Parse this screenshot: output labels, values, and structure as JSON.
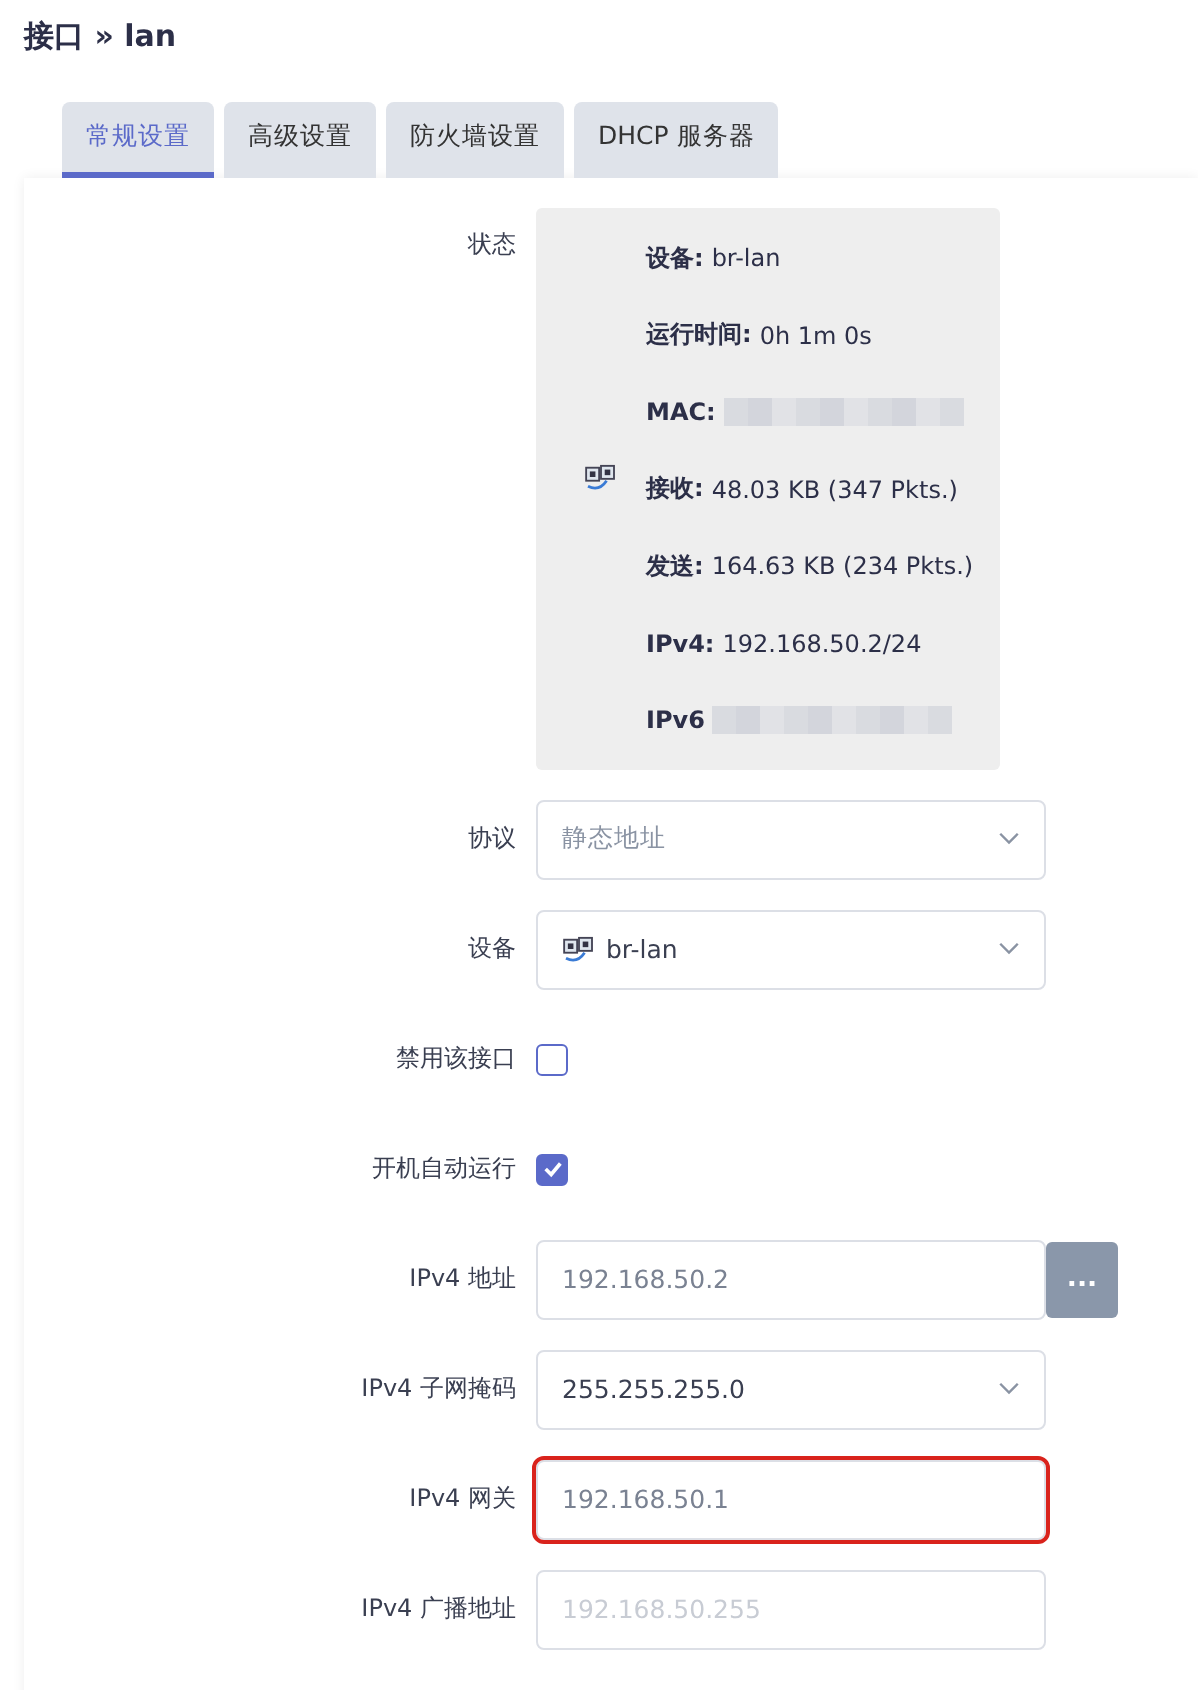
{
  "title": "接口 » lan",
  "tabs": [
    {
      "label": "常规设置",
      "selected": true
    },
    {
      "label": "高级设置",
      "selected": false
    },
    {
      "label": "防火墙设置",
      "selected": false
    },
    {
      "label": "DHCP 服务器",
      "selected": false
    }
  ],
  "status": {
    "label": "状态",
    "lines": [
      {
        "kind": "text",
        "label": "设备:",
        "value": "br-lan"
      },
      {
        "kind": "text",
        "label": "运行时间:",
        "value": "0h 1m 0s"
      },
      {
        "kind": "redacted",
        "label": "MAC:"
      },
      {
        "kind": "text",
        "label": "接收:",
        "value": "48.03 KB (347 Pkts.)"
      },
      {
        "kind": "text",
        "label": "发送:",
        "value": "164.63 KB (234 Pkts.)"
      },
      {
        "kind": "text",
        "label": "IPv4:",
        "value": "192.168.50.2/24"
      },
      {
        "kind": "redacted",
        "label": "IPv6"
      }
    ]
  },
  "fields": [
    {
      "kind": "select",
      "label": "协议",
      "value": "静态地址",
      "muted": true,
      "highlighted": false
    },
    {
      "kind": "device_select",
      "label": "设备",
      "value": "br-lan",
      "muted": false,
      "highlighted": false
    },
    {
      "kind": "checkbox",
      "label": "禁用该接口",
      "checked": false
    },
    {
      "kind": "checkbox",
      "label": "开机自动运行",
      "checked": true
    },
    {
      "kind": "input",
      "label": "IPv4 地址",
      "value": "192.168.50.2",
      "button": "...",
      "highlighted": false
    },
    {
      "kind": "select",
      "label": "IPv4 子网掩码",
      "value": "255.255.255.0",
      "muted": false,
      "highlighted": false
    },
    {
      "kind": "input",
      "label": "IPv4 网关",
      "value": "192.168.50.1",
      "highlighted": true
    },
    {
      "kind": "input",
      "label": "IPv4 广播地址",
      "placeholder": "192.168.50.255",
      "highlighted": false
    }
  ]
}
